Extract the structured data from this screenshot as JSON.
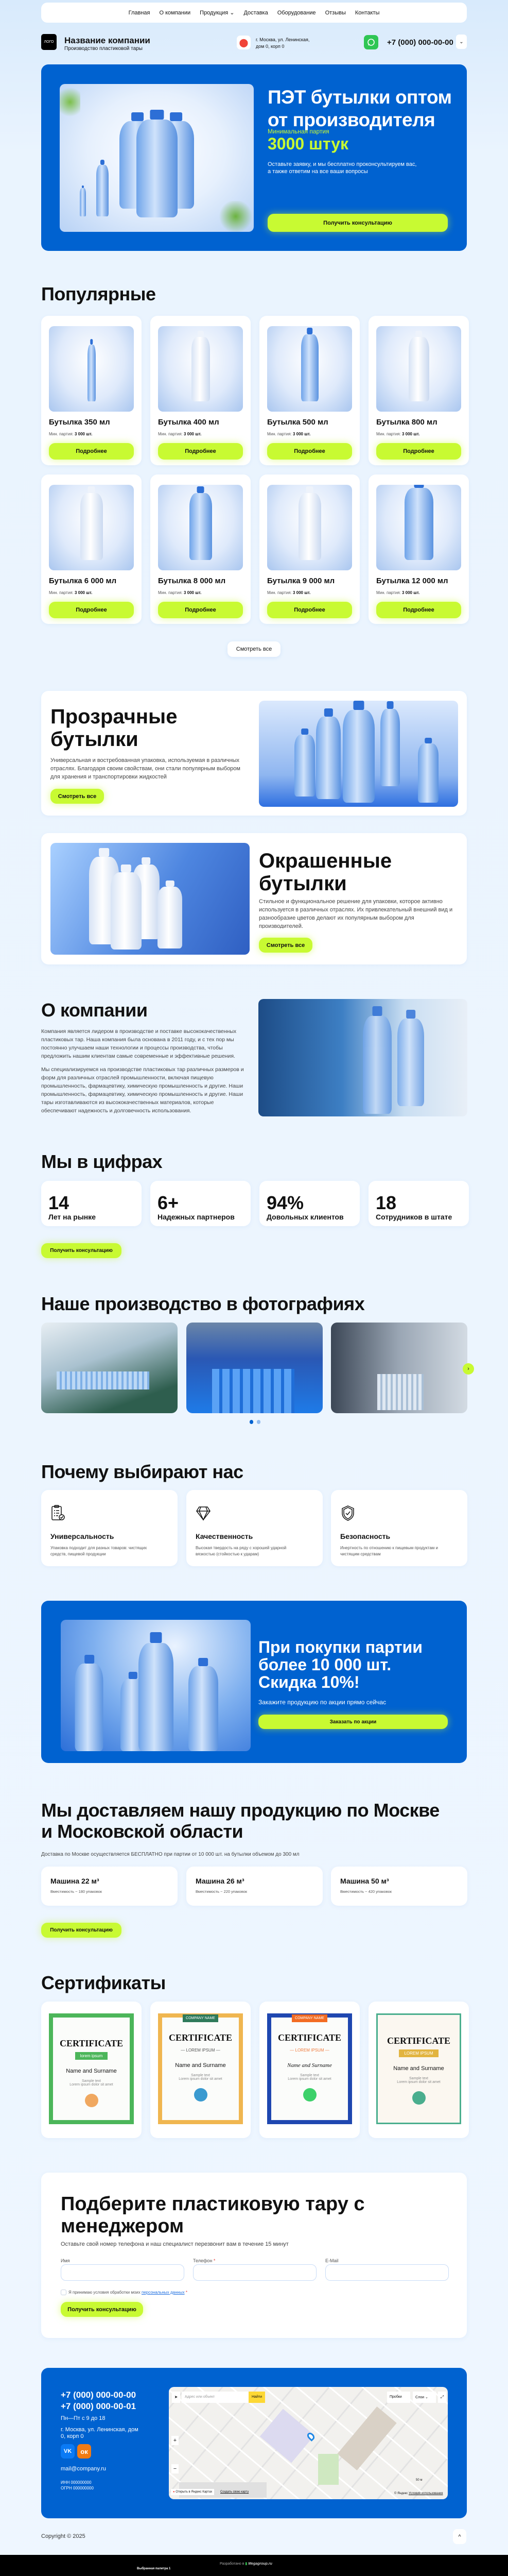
{
  "colors": {
    "brand_blue": "#0062d0",
    "accent_lime": "#c8fa32",
    "background": "#eaf4fe"
  },
  "nav": {
    "items": [
      "Главная",
      "О компании",
      "Продукция",
      "Доставка",
      "Оборудование",
      "Отзывы",
      "Контакты"
    ]
  },
  "header": {
    "logo": "ЛОГО",
    "company": "Название компании",
    "tagline": "Производство пластиковой тары",
    "address_line1": "г. Москва, ул. Ленинская,",
    "address_line2": "дом 0, корп 0",
    "phone": "+7 (000) 000-00-00",
    "icons": [
      "location-pin-icon",
      "whatsapp-icon",
      "chevron-down-icon"
    ]
  },
  "hero": {
    "title_line1": "ПЭТ бутылки оптом",
    "title_line2": "от производителя",
    "min_label": "Минимальная партия",
    "min_value": "3000 штук",
    "text_line1": "Оставьте заявку, и мы бесплатно проконсультируем вас,",
    "text_line2": "а также ответим на все ваши вопросы",
    "button": "Получить консультацию"
  },
  "popular": {
    "title": "Популярные",
    "min_label": "Мин. партия:",
    "button": "Подробнее",
    "view_all": "Смотреть все",
    "products": [
      {
        "name": "Бутылка 350 мл",
        "min": "3 000 шт."
      },
      {
        "name": "Бутылка 400 мл",
        "min": "3 000 шт."
      },
      {
        "name": "Бутылка 500 мл",
        "min": "3 000 шт."
      },
      {
        "name": "Бутылка 800 мл",
        "min": "3 000 шт."
      },
      {
        "name": "Бутылка 6 000 мл",
        "min": "3 000 шт."
      },
      {
        "name": "Бутылка 8 000 мл",
        "min": "3 000 шт."
      },
      {
        "name": "Бутылка 9 000 мл",
        "min": "3 000 шт."
      },
      {
        "name": "Бутылка 12 000 мл",
        "min": "3 000 шт."
      }
    ]
  },
  "categories": [
    {
      "title_line1": "Прозрачные",
      "title_line2": "бутылки",
      "text": "Универсальная и востребованная упаковка, используемая в различных отраслях. Благодаря своим свойствам, они стали популярным выбором для хранения и транспортировки жидкостей",
      "button": "Смотреть все"
    },
    {
      "title_line1": "Окрашенные",
      "title_line2": "бутылки",
      "text": "Стильное и функциональное решение для упаковки, которое активно используется в различных отраслях. Их привлекательный внешний вид и разнообразие цветов делают их популярным выбором для производителей.",
      "button": "Смотреть все"
    }
  ],
  "about": {
    "title": "О компании",
    "p1": "Компания является лидером в производстве и поставке высококачественных пластиковых тар. Наша компания была основана в 2011 году, и с тех пор мы постоянно улучшаем наши технологии и процессы производства, чтобы предложить нашим клиентам самые современные и эффективные решения.",
    "p2": "Мы специализируемся на производстве пластиковых тар различных размеров и форм для различных отраслей промышленности, включая пищевую промышленность, фармацевтику, химическую промышленность и другие. Наши промышленность, фармацевтику, химическую промышленность и другие. Наши тары изготавливаются из высококачественных материалов, которые обеспечивают надежность и долговечность использования."
  },
  "stats": {
    "title": "Мы в цифрах",
    "items": [
      {
        "value": "14",
        "label": "Лет на рынке"
      },
      {
        "value": "6+",
        "label": "Надежных партнеров"
      },
      {
        "value": "94%",
        "label": "Довольных клиентов"
      },
      {
        "value": "18",
        "label": "Сотрудников в штате"
      }
    ],
    "button": "Получить консультацию"
  },
  "gallery": {
    "title": "Наше производство в фотографиях",
    "slides_total": 2,
    "active_slide": 1
  },
  "why": {
    "title": "Почему выбирают нас",
    "items": [
      {
        "icon": "clipboard-check-icon",
        "title": "Универсальность",
        "text": "Упаковка подходит для разных товаров: чистящих средств, пищевой продукции"
      },
      {
        "icon": "diamond-icon",
        "title": "Качественность",
        "text": "Высокая твердость на ряду с хорошей ударной вязкостью (стойкостью к ударам)"
      },
      {
        "icon": "shield-check-icon",
        "title": "Безопасность",
        "text": "Инертность по отношению к пищевым продуктам и чистящим средствам"
      }
    ]
  },
  "promo": {
    "line1": "При покупки партии",
    "line2": "более 10 000 шт.",
    "line3": "Скидка 10%!",
    "subtitle": "Закажите продукцию по акции прямо сейчас",
    "button": "Заказать по акции"
  },
  "delivery": {
    "title_line1": "Мы доставляем нашу продукцию по Москве",
    "title_line2": "и Московской области",
    "subtitle": "Доставка по Москве осуществляется БЕСПЛАТНО при партии от 10 000 шт. на бутылки объемом до 300 мл",
    "trucks": [
      {
        "name": "Машина 22 м³",
        "capacity": "Вместимость ~ 180 упаковок"
      },
      {
        "name": "Машина 26 м³",
        "capacity": "Вместимость ~ 220 упаковок"
      },
      {
        "name": "Машина 50 м³",
        "capacity": "Вместимость ~ 420 упаковок"
      }
    ],
    "button": "Получить консультацию"
  },
  "certificates": {
    "title": "Сертификаты",
    "items": [
      {
        "heading": "CERTIFICATE",
        "ribbon": "lorem ipsum",
        "name": "Name and Surname",
        "sample": "Sample text",
        "lorem": "Lorem ipsum dolor sit amet",
        "color": "#4cb65a"
      },
      {
        "heading": "CERTIFICATE",
        "company": "COMPANY NAME",
        "ribbon": "— LOREM IPSUM —",
        "name": "Name and Surname",
        "sample": "Sample text",
        "lorem": "Lorem ipsum dolor sit amet",
        "color": "#f0b650"
      },
      {
        "heading": "CERTIFICATE",
        "company": "COMPANY NAME",
        "ribbon": "— LOREM IPSUM —",
        "name": "Name and Surname",
        "sample": "Sample text",
        "lorem": "Lorem ipsum dolor sit amet",
        "color": "#1f47b0"
      },
      {
        "heading": "CERTIFICATE",
        "ribbon": "LOREM IPSUM",
        "name": "Name and Surname",
        "sample": "Sample text",
        "lorem": "Lorem ipsum dolor sit amet",
        "color": "#4aae8e"
      }
    ]
  },
  "form": {
    "title_line1": "Подберите пластиковую тару с",
    "title_line2": "менеджером",
    "subtitle": "Оставьте свой номер телефона и наш специалист перезвонит вам в течение 15 минут",
    "name_label": "Имя",
    "phone_label": "Телефон",
    "email_label": "E-Mail",
    "required": "*",
    "consent_text": "Я принимаю условия обработки моих",
    "consent_link": "персональных данных",
    "button": "Получить консультацию"
  },
  "footer": {
    "phone1": "+7 (000) 000-00-00",
    "phone2": "+7 (000) 000-00-01",
    "hours": "Пн—Пт с 9 до 18",
    "address": "г. Москва, ул. Ленинская,  дом 0, корп 0",
    "email": "mail@company.ru",
    "inn": "ИНН 000000000",
    "ogrn": "ОГРН 000000000",
    "social": [
      "vk-icon",
      "odnoklassniki-icon"
    ],
    "map": {
      "search_placeholder": "Адрес или объект",
      "search_button": "Найти",
      "traffic": "Пробки",
      "layers": "Слои",
      "open_link": "Открыть в Яндекс Картах",
      "create_link": "Создать свою карту",
      "copyright": "© Яндекс",
      "terms": "Условия использования",
      "scale": "50 м"
    }
  },
  "copyright": "Copyright © 2025",
  "bottom_bar": {
    "developed": "Разработано в",
    "brand": "Megagroup.ru",
    "palette": "Выбранная палитра 1"
  }
}
